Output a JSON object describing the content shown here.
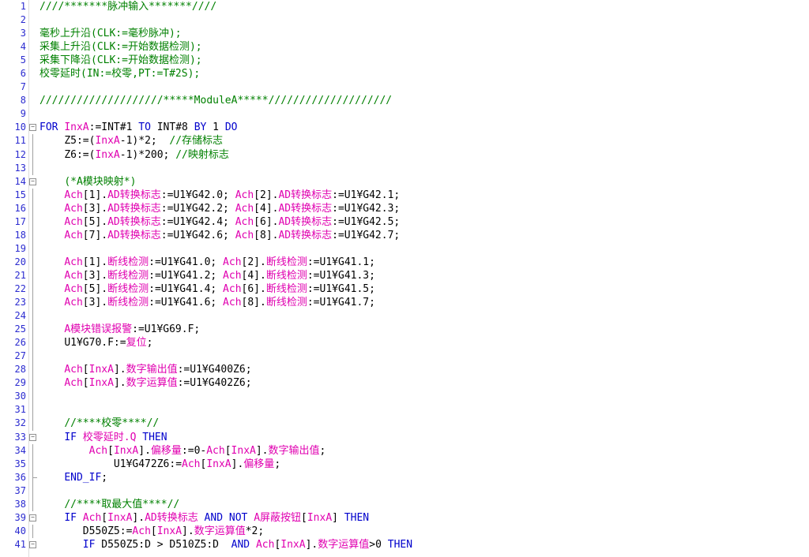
{
  "editor": {
    "lines": [
      {
        "n": "1",
        "fold": "none",
        "ind": 0,
        "t": [
          [
            "c",
            "////*******脉冲输入*******////"
          ]
        ]
      },
      {
        "n": "2",
        "fold": "none",
        "ind": 0,
        "t": []
      },
      {
        "n": "3",
        "fold": "none",
        "ind": 0,
        "t": [
          [
            "c",
            "毫秒上升沿(CLK:=毫秒脉冲);"
          ]
        ]
      },
      {
        "n": "4",
        "fold": "none",
        "ind": 0,
        "t": [
          [
            "c",
            "采集上升沿(CLK:=开始数据检测);"
          ]
        ]
      },
      {
        "n": "5",
        "fold": "none",
        "ind": 0,
        "t": [
          [
            "c",
            "采集下降沿(CLK:=开始数据检测);"
          ]
        ]
      },
      {
        "n": "6",
        "fold": "none",
        "ind": 0,
        "t": [
          [
            "c",
            "校零延时(IN:=校零,PT:=T#2S);"
          ]
        ]
      },
      {
        "n": "7",
        "fold": "none",
        "ind": 0,
        "t": []
      },
      {
        "n": "8",
        "fold": "none",
        "ind": 0,
        "t": [
          [
            "c",
            "////////////////////*****ModuleA*****////////////////////"
          ]
        ]
      },
      {
        "n": "9",
        "fold": "none",
        "ind": 0,
        "t": []
      },
      {
        "n": "10",
        "fold": "box",
        "ind": 0,
        "t": [
          [
            "k",
            "FOR "
          ],
          [
            "v",
            "InxA"
          ],
          [
            "n",
            ":=INT#1 "
          ],
          [
            "k",
            "TO"
          ],
          [
            "n",
            " INT#8 "
          ],
          [
            "k",
            "BY"
          ],
          [
            "n",
            " 1 "
          ],
          [
            "k",
            "DO"
          ]
        ]
      },
      {
        "n": "11",
        "fold": "line",
        "ind": 4,
        "t": [
          [
            "n",
            "Z5:=("
          ],
          [
            "v",
            "InxA"
          ],
          [
            "n",
            "-1)*2;  "
          ],
          [
            "c",
            "//存储标志"
          ]
        ]
      },
      {
        "n": "12",
        "fold": "line",
        "ind": 4,
        "t": [
          [
            "n",
            "Z6:=("
          ],
          [
            "v",
            "InxA"
          ],
          [
            "n",
            "-1)*200; "
          ],
          [
            "c",
            "//映射标志"
          ]
        ]
      },
      {
        "n": "13",
        "fold": "line",
        "ind": 0,
        "t": []
      },
      {
        "n": "14",
        "fold": "box",
        "ind": 4,
        "t": [
          [
            "c",
            "(*A模块映射*)"
          ]
        ]
      },
      {
        "n": "15",
        "fold": "line",
        "ind": 4,
        "t": [
          [
            "v",
            "Ach"
          ],
          [
            "n",
            "[1]."
          ],
          [
            "v",
            "AD转换标志"
          ],
          [
            "n",
            ":=U1¥G42.0; "
          ],
          [
            "v",
            "Ach"
          ],
          [
            "n",
            "[2]."
          ],
          [
            "v",
            "AD转换标志"
          ],
          [
            "n",
            ":=U1¥G42.1;"
          ]
        ]
      },
      {
        "n": "16",
        "fold": "line",
        "ind": 4,
        "t": [
          [
            "v",
            "Ach"
          ],
          [
            "n",
            "[3]."
          ],
          [
            "v",
            "AD转换标志"
          ],
          [
            "n",
            ":=U1¥G42.2; "
          ],
          [
            "v",
            "Ach"
          ],
          [
            "n",
            "[4]."
          ],
          [
            "v",
            "AD转换标志"
          ],
          [
            "n",
            ":=U1¥G42.3;"
          ]
        ]
      },
      {
        "n": "17",
        "fold": "line",
        "ind": 4,
        "t": [
          [
            "v",
            "Ach"
          ],
          [
            "n",
            "[5]."
          ],
          [
            "v",
            "AD转换标志"
          ],
          [
            "n",
            ":=U1¥G42.4; "
          ],
          [
            "v",
            "Ach"
          ],
          [
            "n",
            "[6]."
          ],
          [
            "v",
            "AD转换标志"
          ],
          [
            "n",
            ":=U1¥G42.5;"
          ]
        ]
      },
      {
        "n": "18",
        "fold": "line",
        "ind": 4,
        "t": [
          [
            "v",
            "Ach"
          ],
          [
            "n",
            "[7]."
          ],
          [
            "v",
            "AD转换标志"
          ],
          [
            "n",
            ":=U1¥G42.6; "
          ],
          [
            "v",
            "Ach"
          ],
          [
            "n",
            "[8]."
          ],
          [
            "v",
            "AD转换标志"
          ],
          [
            "n",
            ":=U1¥G42.7;"
          ]
        ]
      },
      {
        "n": "19",
        "fold": "line",
        "ind": 0,
        "t": []
      },
      {
        "n": "20",
        "fold": "line",
        "ind": 4,
        "t": [
          [
            "v",
            "Ach"
          ],
          [
            "n",
            "[1]."
          ],
          [
            "v",
            "断线检测"
          ],
          [
            "n",
            ":=U1¥G41.0; "
          ],
          [
            "v",
            "Ach"
          ],
          [
            "n",
            "[2]."
          ],
          [
            "v",
            "断线检测"
          ],
          [
            "n",
            ":=U1¥G41.1;"
          ]
        ]
      },
      {
        "n": "21",
        "fold": "line",
        "ind": 4,
        "t": [
          [
            "v",
            "Ach"
          ],
          [
            "n",
            "[3]."
          ],
          [
            "v",
            "断线检测"
          ],
          [
            "n",
            ":=U1¥G41.2; "
          ],
          [
            "v",
            "Ach"
          ],
          [
            "n",
            "[4]."
          ],
          [
            "v",
            "断线检测"
          ],
          [
            "n",
            ":=U1¥G41.3;"
          ]
        ]
      },
      {
        "n": "22",
        "fold": "line",
        "ind": 4,
        "t": [
          [
            "v",
            "Ach"
          ],
          [
            "n",
            "[5]."
          ],
          [
            "v",
            "断线检测"
          ],
          [
            "n",
            ":=U1¥G41.4; "
          ],
          [
            "v",
            "Ach"
          ],
          [
            "n",
            "[6]."
          ],
          [
            "v",
            "断线检测"
          ],
          [
            "n",
            ":=U1¥G41.5;"
          ]
        ]
      },
      {
        "n": "23",
        "fold": "line",
        "ind": 4,
        "t": [
          [
            "v",
            "Ach"
          ],
          [
            "n",
            "[3]."
          ],
          [
            "v",
            "断线检测"
          ],
          [
            "n",
            ":=U1¥G41.6; "
          ],
          [
            "v",
            "Ach"
          ],
          [
            "n",
            "[8]."
          ],
          [
            "v",
            "断线检测"
          ],
          [
            "n",
            ":=U1¥G41.7;"
          ]
        ]
      },
      {
        "n": "24",
        "fold": "line",
        "ind": 0,
        "t": []
      },
      {
        "n": "25",
        "fold": "line",
        "ind": 4,
        "t": [
          [
            "v",
            "A模块错误报警"
          ],
          [
            "n",
            ":=U1¥G69.F;"
          ]
        ]
      },
      {
        "n": "26",
        "fold": "line",
        "ind": 4,
        "t": [
          [
            "n",
            "U1¥G70.F:="
          ],
          [
            "v",
            "复位"
          ],
          [
            "n",
            ";"
          ]
        ]
      },
      {
        "n": "27",
        "fold": "line",
        "ind": 0,
        "t": []
      },
      {
        "n": "28",
        "fold": "line",
        "ind": 4,
        "t": [
          [
            "v",
            "Ach"
          ],
          [
            "n",
            "["
          ],
          [
            "v",
            "InxA"
          ],
          [
            "n",
            "]."
          ],
          [
            "v",
            "数字输出值"
          ],
          [
            "n",
            ":=U1¥G400Z6;"
          ]
        ]
      },
      {
        "n": "29",
        "fold": "line",
        "ind": 4,
        "t": [
          [
            "v",
            "Ach"
          ],
          [
            "n",
            "["
          ],
          [
            "v",
            "InxA"
          ],
          [
            "n",
            "]."
          ],
          [
            "v",
            "数字运算值"
          ],
          [
            "n",
            ":=U1¥G402Z6;"
          ]
        ]
      },
      {
        "n": "30",
        "fold": "line",
        "ind": 0,
        "t": []
      },
      {
        "n": "31",
        "fold": "line",
        "ind": 0,
        "t": []
      },
      {
        "n": "32",
        "fold": "line",
        "ind": 4,
        "t": [
          [
            "c",
            "//****校零****//"
          ]
        ]
      },
      {
        "n": "33",
        "fold": "box",
        "ind": 4,
        "t": [
          [
            "k",
            "IF "
          ],
          [
            "v",
            "校零延时.Q"
          ],
          [
            "k",
            " THEN"
          ]
        ]
      },
      {
        "n": "34",
        "fold": "line",
        "ind": 8,
        "t": [
          [
            "v",
            "Ach"
          ],
          [
            "n",
            "["
          ],
          [
            "v",
            "InxA"
          ],
          [
            "n",
            "]."
          ],
          [
            "v",
            "偏移量"
          ],
          [
            "n",
            ":=0-"
          ],
          [
            "v",
            "Ach"
          ],
          [
            "n",
            "["
          ],
          [
            "v",
            "InxA"
          ],
          [
            "n",
            "]."
          ],
          [
            "v",
            "数字输出值"
          ],
          [
            "n",
            ";"
          ]
        ]
      },
      {
        "n": "35",
        "fold": "line",
        "ind": 12,
        "t": [
          [
            "n",
            "U1¥G472Z6:="
          ],
          [
            "v",
            "Ach"
          ],
          [
            "n",
            "["
          ],
          [
            "v",
            "InxA"
          ],
          [
            "n",
            "]."
          ],
          [
            "v",
            "偏移量"
          ],
          [
            "n",
            ";"
          ]
        ]
      },
      {
        "n": "36",
        "fold": "end",
        "ind": 4,
        "t": [
          [
            "k",
            "END_IF"
          ],
          [
            "n",
            ";"
          ]
        ]
      },
      {
        "n": "37",
        "fold": "line",
        "ind": 0,
        "t": []
      },
      {
        "n": "38",
        "fold": "line",
        "ind": 4,
        "t": [
          [
            "c",
            "//****取最大值****//"
          ]
        ]
      },
      {
        "n": "39",
        "fold": "box",
        "ind": 4,
        "t": [
          [
            "k",
            "IF "
          ],
          [
            "v",
            "Ach"
          ],
          [
            "n",
            "["
          ],
          [
            "v",
            "InxA"
          ],
          [
            "n",
            "]."
          ],
          [
            "v",
            "AD转换标志"
          ],
          [
            "k",
            " AND NOT "
          ],
          [
            "v",
            "A屏蔽按钮"
          ],
          [
            "n",
            "["
          ],
          [
            "v",
            "InxA"
          ],
          [
            "n",
            "]"
          ],
          [
            "k",
            " THEN"
          ]
        ]
      },
      {
        "n": "40",
        "fold": "line",
        "ind": 7,
        "t": [
          [
            "n",
            "D550Z5:="
          ],
          [
            "v",
            "Ach"
          ],
          [
            "n",
            "["
          ],
          [
            "v",
            "InxA"
          ],
          [
            "n",
            "]."
          ],
          [
            "v",
            "数字运算值"
          ],
          [
            "n",
            "*2;"
          ]
        ]
      },
      {
        "n": "41",
        "fold": "box",
        "ind": 7,
        "t": [
          [
            "k",
            "IF "
          ],
          [
            "n",
            "D550Z5:D > D510Z5:D  "
          ],
          [
            "k",
            "AND "
          ],
          [
            "v",
            "Ach"
          ],
          [
            "n",
            "["
          ],
          [
            "v",
            "InxA"
          ],
          [
            "n",
            "]."
          ],
          [
            "v",
            "数字运算值"
          ],
          [
            "n",
            ">0 "
          ],
          [
            "k",
            "THEN"
          ]
        ]
      }
    ]
  },
  "colors": {
    "comment": "#008000",
    "keyword": "#0000cc",
    "variable": "#e000b0",
    "line_number": "#2b2bd0"
  }
}
